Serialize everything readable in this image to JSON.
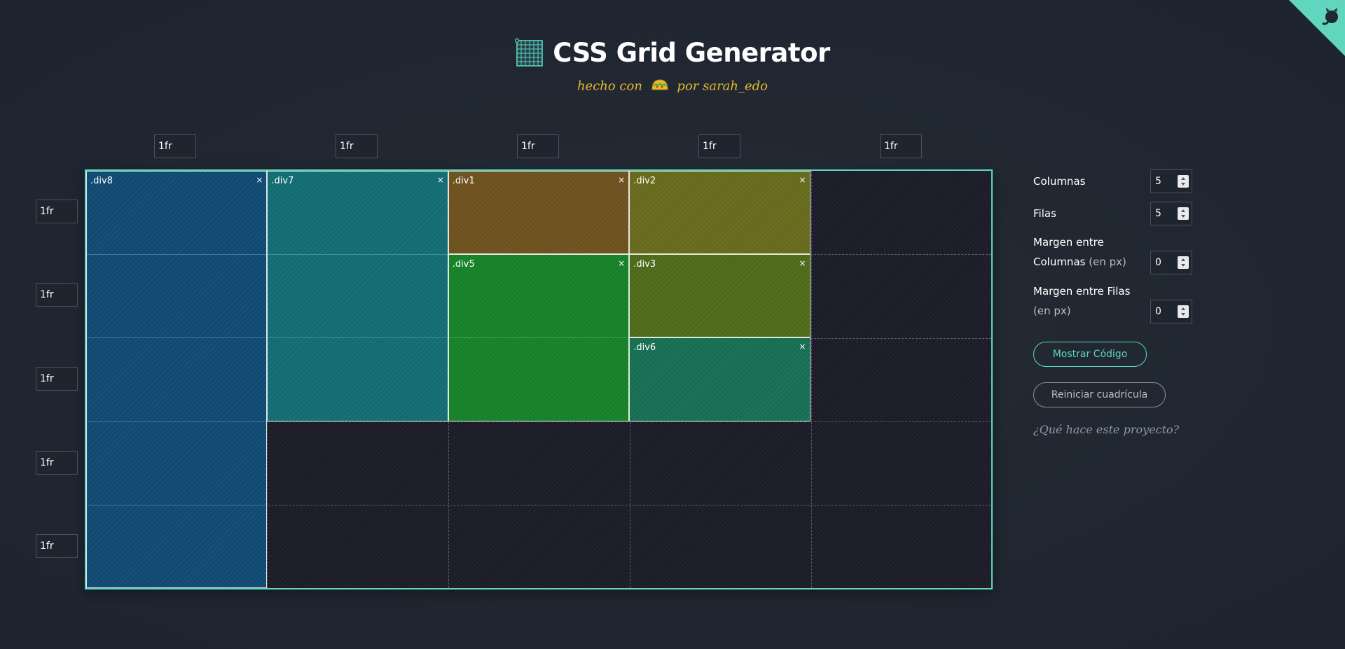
{
  "header": {
    "title": "CSS Grid Generator",
    "subtitle_before": "hecho con",
    "subtitle_after": "por sarah_edo",
    "title_icon": "grid-icon",
    "subtitle_icon": "taco-icon"
  },
  "corner_icon": "github-octocat-icon",
  "columns": [
    "1fr",
    "1fr",
    "1fr",
    "1fr",
    "1fr"
  ],
  "rows": [
    "1fr",
    "1fr",
    "1fr",
    "1fr",
    "1fr"
  ],
  "items": [
    {
      "label": ".div8",
      "col_start": 1,
      "col_end": 2,
      "row_start": 1,
      "row_end": 6,
      "color": "#104a72"
    },
    {
      "label": ".div7",
      "col_start": 2,
      "col_end": 3,
      "row_start": 1,
      "row_end": 4,
      "color": "#136c72"
    },
    {
      "label": ".div1",
      "col_start": 3,
      "col_end": 4,
      "row_start": 1,
      "row_end": 2,
      "color": "#6d511e"
    },
    {
      "label": ".div2",
      "col_start": 4,
      "col_end": 5,
      "row_start": 1,
      "row_end": 2,
      "color": "#676a1d"
    },
    {
      "label": ".div5",
      "col_start": 3,
      "col_end": 4,
      "row_start": 2,
      "row_end": 4,
      "color": "#168128"
    },
    {
      "label": ".div3",
      "col_start": 4,
      "col_end": 5,
      "row_start": 2,
      "row_end": 3,
      "color": "#4e6a19"
    },
    {
      "label": ".div6",
      "col_start": 4,
      "col_end": 5,
      "row_start": 3,
      "row_end": 4,
      "color": "#176e53"
    }
  ],
  "item_close_label": "×",
  "controls": {
    "columns_label": "Columnas",
    "columns_value": "5",
    "rows_label": "Filas",
    "rows_value": "5",
    "col_gap_label_line1": "Margen entre",
    "col_gap_label_line2": "Columnas",
    "col_gap_unit": "(en px)",
    "col_gap_value": "0",
    "row_gap_label_line1": "Margen entre Filas",
    "row_gap_unit": "(en px)",
    "row_gap_value": "0",
    "show_code_label": "Mostrar Código",
    "reset_label": "Reiniciar cuadrícula",
    "about_link": "¿Qué hace este proyecto?"
  },
  "colors": {
    "accent": "#5fd6bd",
    "subtitle": "#e8b92d",
    "background": "#212832"
  }
}
